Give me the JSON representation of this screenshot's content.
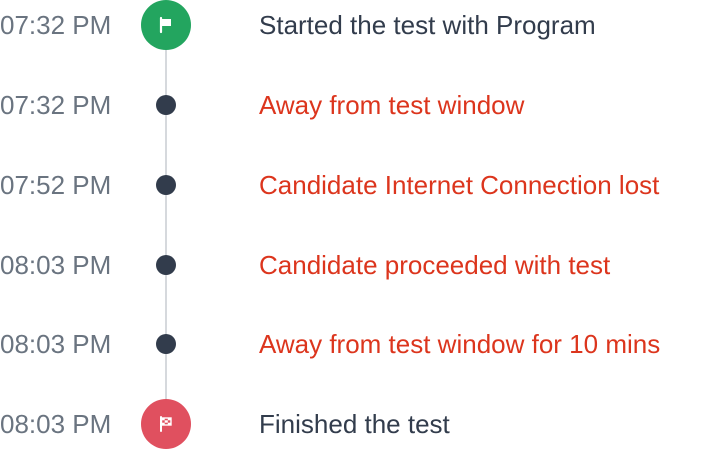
{
  "timeline": {
    "events": [
      {
        "time": "07:32 PM",
        "label": "Started the test with Program",
        "kind": "start",
        "icon": "flag-icon",
        "color": "#23a55f"
      },
      {
        "time": "07:32 PM",
        "label": "Away from test window",
        "kind": "alert",
        "icon": "dot-icon",
        "color": "#dc351d"
      },
      {
        "time": "07:52 PM",
        "label": "Candidate Internet Connection lost",
        "kind": "alert",
        "icon": "dot-icon",
        "color": "#dc351d"
      },
      {
        "time": "08:03 PM",
        "label": "Candidate proceeded with test",
        "kind": "alert",
        "icon": "dot-icon",
        "color": "#dc351d"
      },
      {
        "time": "08:03 PM",
        "label": "Away from test window for 10 mins",
        "kind": "alert",
        "icon": "dot-icon",
        "color": "#dc351d"
      },
      {
        "time": "08:03 PM",
        "label": "Finished the test",
        "kind": "finish",
        "icon": "checkered-flag-icon",
        "color": "#e0505f"
      }
    ]
  }
}
